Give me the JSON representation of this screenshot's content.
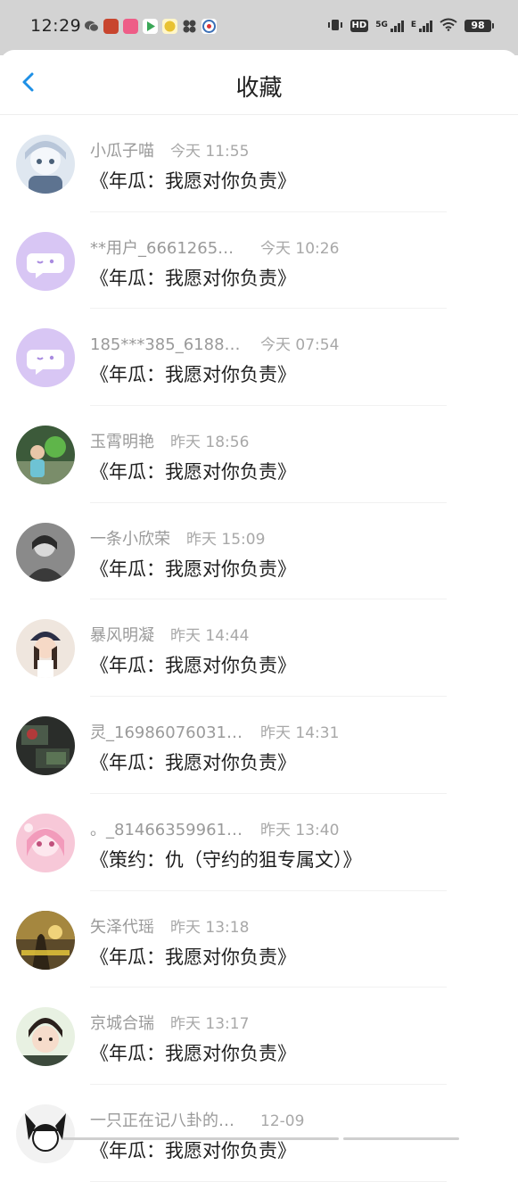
{
  "status_bar": {
    "time": "12:29",
    "network": "5G",
    "network_e": "E",
    "hd": "HD",
    "battery": "98",
    "apps": [
      {
        "name": "wechat-icon",
        "color": "#555555"
      },
      {
        "name": "game-app-icon",
        "color": "#c8452e"
      },
      {
        "name": "pink-app-icon",
        "color": "#ee5d87"
      },
      {
        "name": "play-app-icon",
        "color": "#3aa757"
      },
      {
        "name": "emoji-app-icon",
        "color": "#e8c232"
      },
      {
        "name": "pinwheel-app-icon",
        "color": "#444444"
      },
      {
        "name": "badge-app-icon",
        "color": "#3b6fb6"
      }
    ]
  },
  "header": {
    "title": "收藏",
    "back_icon": "chevron-left-icon",
    "accent": "#1e90e6"
  },
  "items": [
    {
      "name": "小瓜子喵",
      "time": "今天 11:55",
      "book": "《年瓜：我愿对你负责》",
      "avatar": "anime-girl"
    },
    {
      "name": "**用户_6661265…",
      "time": "今天 10:26",
      "book": "《年瓜：我愿对你负责》",
      "avatar": "default"
    },
    {
      "name": "185***385_6188…",
      "time": "今天 07:54",
      "book": "《年瓜：我愿对你负责》",
      "avatar": "default"
    },
    {
      "name": "玉霄明艳",
      "time": "昨天 18:56",
      "book": "《年瓜：我愿对你负责》",
      "avatar": "child-photo"
    },
    {
      "name": "一条小欣荣",
      "time": "昨天 15:09",
      "book": "《年瓜：我愿对你负责》",
      "avatar": "bw-photo"
    },
    {
      "name": "暴风明凝",
      "time": "昨天 14:44",
      "book": "《年瓜：我愿对你负责》",
      "avatar": "girl-cap"
    },
    {
      "name": "灵_16986076031…",
      "time": "昨天 14:31",
      "book": "《年瓜：我愿对你负责》",
      "avatar": "dark-photo"
    },
    {
      "name": "。_81466359961…",
      "time": "昨天 13:40",
      "book": "《策约：仇（守约的狙专属文）》",
      "avatar": "pink-anime"
    },
    {
      "name": "矢泽代瑶",
      "time": "昨天 13:18",
      "book": "《年瓜：我愿对你负责》",
      "avatar": "sunset-photo"
    },
    {
      "name": "京城合瑞",
      "time": "昨天 13:17",
      "book": "《年瓜：我愿对你负责》",
      "avatar": "kid-face"
    },
    {
      "name": "一只正在记八卦的…",
      "time": "12-09",
      "book": "《年瓜：我愿对你负责》",
      "avatar": "ink-anime"
    }
  ]
}
